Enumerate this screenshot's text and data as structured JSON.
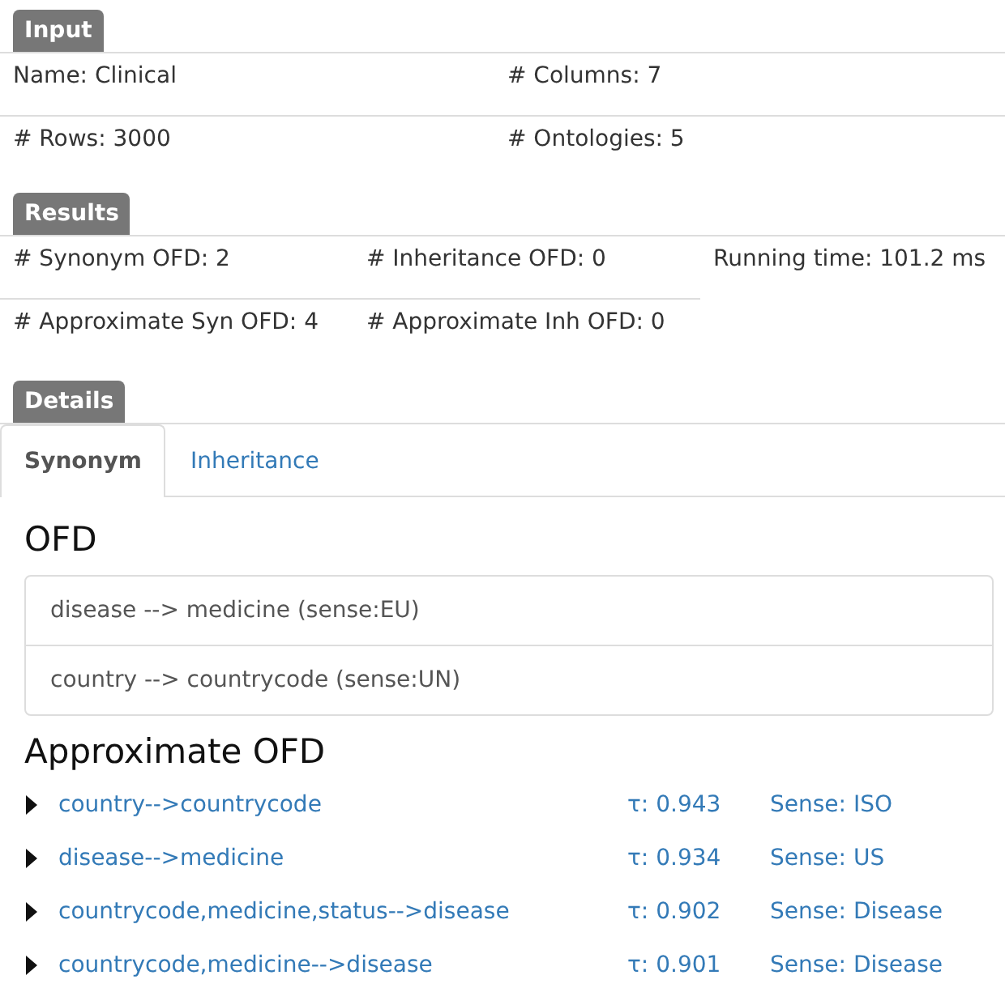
{
  "input": {
    "label": "Input",
    "rows": [
      [
        "Name: Clinical",
        "# Columns: 7"
      ],
      [
        "# Rows: 3000",
        "# Ontologies: 5"
      ]
    ]
  },
  "results": {
    "label": "Results",
    "rows": [
      [
        "# Synonym OFD: 2",
        "# Inheritance OFD: 0",
        "Running time: 101.2 ms"
      ],
      [
        "# Approximate Syn OFD: 4",
        "# Approximate Inh OFD: 0"
      ]
    ]
  },
  "details": {
    "label": "Details",
    "tabs": [
      {
        "label": "Synonym",
        "selected": true
      },
      {
        "label": "Inheritance",
        "selected": false
      }
    ],
    "ofd": {
      "heading": "OFD",
      "items": [
        "disease --> medicine (sense:EU)",
        "country --> countrycode (sense:UN)"
      ]
    },
    "approximate_ofd": {
      "heading": "Approximate OFD",
      "items": [
        {
          "dependency": "country-->countrycode",
          "tau": "τ: 0.943",
          "sense": "Sense: ISO",
          "expanded": false
        },
        {
          "dependency": "disease-->medicine",
          "tau": "τ: 0.934",
          "sense": "Sense: US",
          "expanded": false
        },
        {
          "dependency": "countrycode,medicine,status-->disease",
          "tau": "τ: 0.902",
          "sense": "Sense: Disease",
          "expanded": false
        },
        {
          "dependency": "countrycode,medicine-->disease",
          "tau": "τ: 0.901",
          "sense": "Sense: Disease",
          "expanded": false
        }
      ]
    }
  }
}
